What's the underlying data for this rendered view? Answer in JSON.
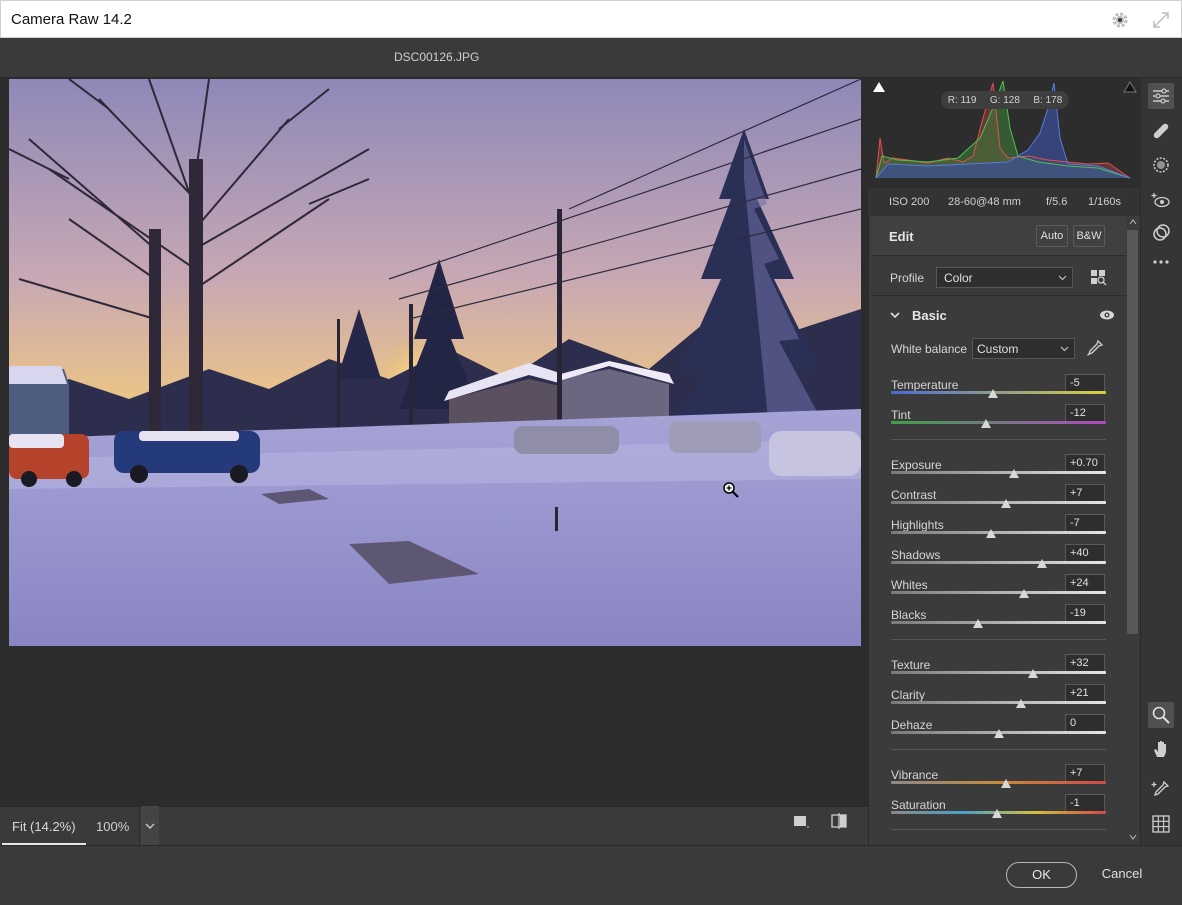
{
  "window": {
    "title": "Camera Raw 14.2"
  },
  "file": {
    "name": "DSC00126.JPG"
  },
  "histogram": {
    "readout": {
      "r": "R: 119",
      "g": "G: 128",
      "b": "B: 178"
    }
  },
  "exif": {
    "iso": "ISO 200",
    "lens": "28-60@48 mm",
    "aperture": "f/5.6",
    "shutter": "1/160s"
  },
  "edit": {
    "title": "Edit",
    "auto_label": "Auto",
    "bw_label": "B&W"
  },
  "profile": {
    "label": "Profile",
    "value": "Color"
  },
  "basic": {
    "title": "Basic",
    "white_balance": {
      "label": "White balance",
      "value": "Custom"
    },
    "sliders": [
      {
        "label": "Temperature",
        "value": "-5",
        "pos": 0.475
      },
      {
        "label": "Tint",
        "value": "-12",
        "pos": 0.44
      },
      {
        "label": "Exposure",
        "value": "+0.70",
        "pos": 0.57
      },
      {
        "label": "Contrast",
        "value": "+7",
        "pos": 0.535
      },
      {
        "label": "Highlights",
        "value": "-7",
        "pos": 0.465
      },
      {
        "label": "Shadows",
        "value": "+40",
        "pos": 0.7
      },
      {
        "label": "Whites",
        "value": "+24",
        "pos": 0.62
      },
      {
        "label": "Blacks",
        "value": "-19",
        "pos": 0.405
      },
      {
        "label": "Texture",
        "value": "+32",
        "pos": 0.66
      },
      {
        "label": "Clarity",
        "value": "+21",
        "pos": 0.605
      },
      {
        "label": "Dehaze",
        "value": "0",
        "pos": 0.5
      },
      {
        "label": "Vibrance",
        "value": "+7",
        "pos": 0.535
      },
      {
        "label": "Saturation",
        "value": "-1",
        "pos": 0.495
      }
    ]
  },
  "zoom": {
    "fit_label": "Fit (14.2%)",
    "pct_label": "100%"
  },
  "footer": {
    "ok_label": "OK",
    "cancel_label": "Cancel"
  },
  "colors": {
    "panel": "#3b3b3b",
    "canvas": "#2c2c2c",
    "accent": "#e6e6e6"
  }
}
